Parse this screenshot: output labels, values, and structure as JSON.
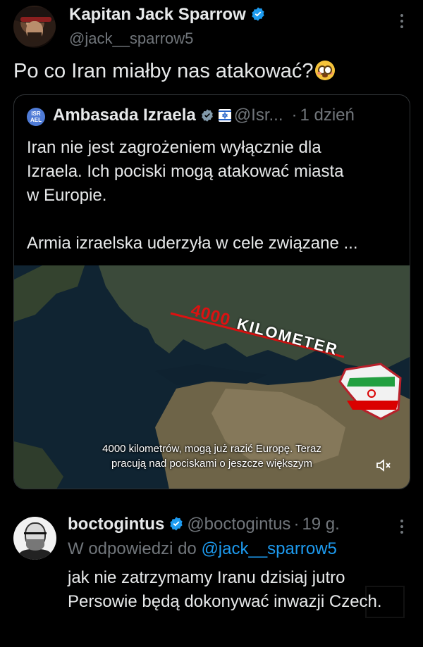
{
  "tweet": {
    "author_name": "Kapitan Jack Sparrow",
    "author_handle": "@jack__sparrow5",
    "text": "Po co Iran miałby nas atakować?",
    "emoji": "flushed-face"
  },
  "quote": {
    "author_name": "Ambasada Izraela",
    "icon_text": "ISR AEL",
    "handle": "@Isr...",
    "separator": "·",
    "time": "1 dzień",
    "body_lines": [
      "Iran nie jest zagrożeniem wyłącznie dla",
      "Izraela. Ich pociski mogą atakować miasta",
      "w Europie.",
      "Armia izraelska uderzyła w cele związane ..."
    ],
    "media": {
      "distance_number": "4000",
      "distance_label": "KILOMETER",
      "caption_lines": [
        "4000 kilometrów, mogą już razić Europę. Teraz",
        "pracują nad pociskami o jeszcze większym"
      ]
    }
  },
  "reply": {
    "author_name": "boctogintus",
    "handle": "@boctogintus",
    "separator": "·",
    "time": "19 g.",
    "reply_prefix": "W odpowiedzi do",
    "reply_to": "@jack__sparrow5",
    "body": "jak nie zatrzymamy Iranu dzisiaj jutro Persowie będą dokonywać inwazji Czech."
  },
  "colors": {
    "background": "#000000",
    "text": "#e7e9ea",
    "muted": "#71767b",
    "link": "#1d9bf0",
    "verified": "#1d9bf0",
    "border": "#2f3336"
  }
}
